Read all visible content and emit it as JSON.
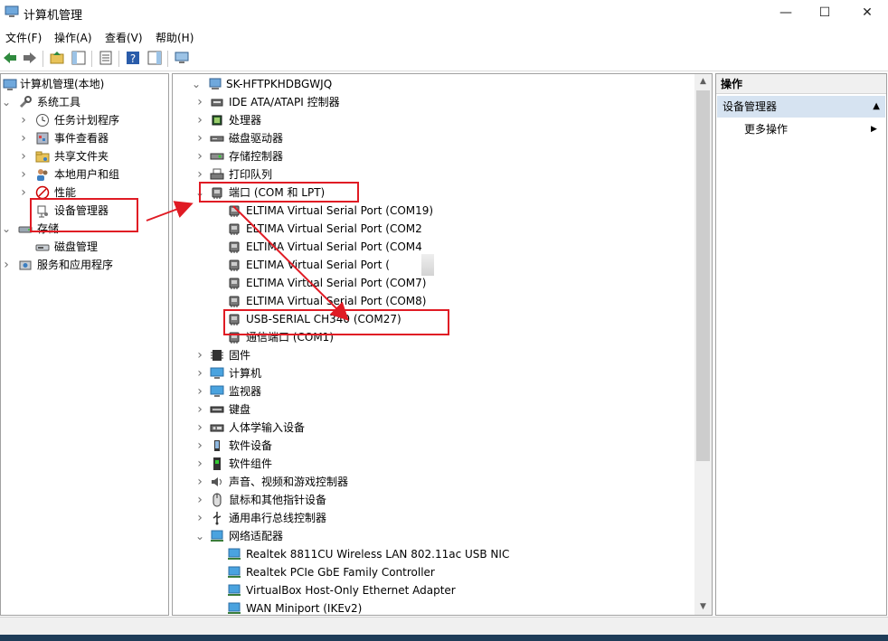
{
  "window": {
    "title": "计算机管理"
  },
  "menu": [
    "文件(F)",
    "操作(A)",
    "查看(V)",
    "帮助(H)"
  ],
  "left_tree": [
    {
      "label": "计算机管理(本地)",
      "icon": "computer-management-icon",
      "expander": ""
    },
    {
      "label": "系统工具",
      "icon": "tools-icon",
      "expander": "expanded"
    },
    {
      "label": "任务计划程序",
      "icon": "clock-icon",
      "expander": "collapsed"
    },
    {
      "label": "事件查看器",
      "icon": "event-viewer-icon",
      "expander": "collapsed"
    },
    {
      "label": "共享文件夹",
      "icon": "shared-folder-icon",
      "expander": "collapsed"
    },
    {
      "label": "本地用户和组",
      "icon": "users-icon",
      "expander": "collapsed"
    },
    {
      "label": "性能",
      "icon": "performance-icon",
      "expander": "collapsed"
    },
    {
      "label": "设备管理器",
      "icon": "device-manager-icon",
      "expander": ""
    },
    {
      "label": "存储",
      "icon": "storage-icon",
      "expander": "expanded"
    },
    {
      "label": "磁盘管理",
      "icon": "disk-management-icon",
      "expander": ""
    },
    {
      "label": "服务和应用程序",
      "icon": "services-icon",
      "expander": "collapsed"
    }
  ],
  "device_tree": [
    {
      "label": "SK-HFTPKHDBGWJQ",
      "icon": "computer-icon",
      "expander": "expanded"
    },
    {
      "label": "IDE ATA/ATAPI 控制器",
      "icon": "ide-controller-icon",
      "expander": "collapsed"
    },
    {
      "label": "处理器",
      "icon": "processor-icon",
      "expander": "collapsed"
    },
    {
      "label": "磁盘驱动器",
      "icon": "disk-drive-icon",
      "expander": "collapsed"
    },
    {
      "label": "存储控制器",
      "icon": "storage-controller-icon",
      "expander": "collapsed"
    },
    {
      "label": "打印队列",
      "icon": "printer-icon",
      "expander": "collapsed"
    },
    {
      "label": "端口 (COM 和 LPT)",
      "icon": "port-icon",
      "expander": "expanded"
    },
    {
      "label": "ELTIMA Virtual Serial Port (COM19)",
      "icon": "port-icon",
      "expander": ""
    },
    {
      "label": "ELTIMA Virtual Serial Port (COM2",
      "icon": "port-icon",
      "expander": ""
    },
    {
      "label": "ELTIMA Virtual Serial Port (COM4",
      "icon": "port-icon",
      "expander": ""
    },
    {
      "label": "ELTIMA Virtual Serial Port (",
      "icon": "port-icon",
      "expander": ""
    },
    {
      "label": "ELTIMA Virtual Serial Port (COM7)",
      "icon": "port-icon",
      "expander": ""
    },
    {
      "label": "ELTIMA Virtual Serial Port (COM8)",
      "icon": "port-icon",
      "expander": ""
    },
    {
      "label": "USB-SERIAL CH340 (COM27)",
      "icon": "port-icon",
      "expander": ""
    },
    {
      "label": "通信端口 (COM1)",
      "icon": "port-icon",
      "expander": ""
    },
    {
      "label": "固件",
      "icon": "firmware-icon",
      "expander": "collapsed"
    },
    {
      "label": "计算机",
      "icon": "monitor-icon",
      "expander": "collapsed"
    },
    {
      "label": "监视器",
      "icon": "monitor-icon",
      "expander": "collapsed"
    },
    {
      "label": "键盘",
      "icon": "keyboard-icon",
      "expander": "collapsed"
    },
    {
      "label": "人体学输入设备",
      "icon": "hid-icon",
      "expander": "collapsed"
    },
    {
      "label": "软件设备",
      "icon": "software-device-icon",
      "expander": "collapsed"
    },
    {
      "label": "软件组件",
      "icon": "software-component-icon",
      "expander": "collapsed"
    },
    {
      "label": "声音、视频和游戏控制器",
      "icon": "speaker-icon",
      "expander": "collapsed"
    },
    {
      "label": "鼠标和其他指针设备",
      "icon": "mouse-icon",
      "expander": "collapsed"
    },
    {
      "label": "通用串行总线控制器",
      "icon": "usb-icon",
      "expander": "collapsed"
    },
    {
      "label": "网络适配器",
      "icon": "network-icon",
      "expander": "expanded"
    },
    {
      "label": "Realtek 8811CU Wireless LAN 802.11ac USB NIC",
      "icon": "network-icon",
      "expander": ""
    },
    {
      "label": "Realtek PCIe GbE Family Controller",
      "icon": "network-icon",
      "expander": ""
    },
    {
      "label": "VirtualBox Host-Only Ethernet Adapter",
      "icon": "network-icon",
      "expander": ""
    },
    {
      "label": "WAN Miniport (IKEv2)",
      "icon": "network-icon",
      "expander": ""
    }
  ],
  "actions": {
    "header": "操作",
    "section": "设备管理器",
    "more": "更多操作"
  },
  "colors": {
    "highlight": "#e01b24",
    "section_bg": "#d6e3f1",
    "accent_blue": "#3c7fc1"
  }
}
